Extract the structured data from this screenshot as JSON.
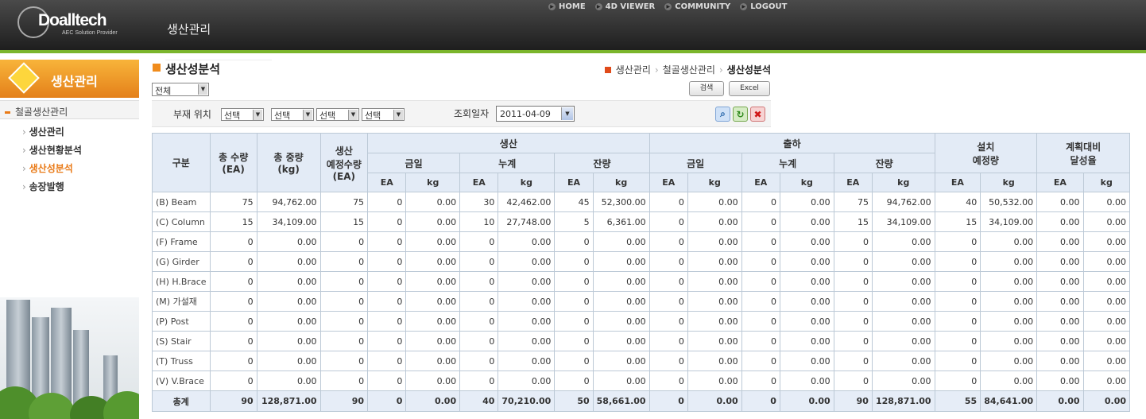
{
  "header": {
    "brand": "Doalltech",
    "brand_sub": "AEC Solution Provider",
    "section_title": "생산관리",
    "nav": [
      {
        "label": "HOME"
      },
      {
        "label": "4D VIEWER"
      },
      {
        "label": "COMMUNITY"
      },
      {
        "label": "LOGOUT"
      }
    ]
  },
  "sidebar": {
    "title": "생산관리",
    "group": "철골생산관리",
    "items": [
      {
        "label": "생산관리",
        "active": false
      },
      {
        "label": "생산현황분석",
        "active": false
      },
      {
        "label": "생산성분석",
        "active": true
      },
      {
        "label": "송장발행",
        "active": false
      }
    ]
  },
  "page": {
    "title": "생산성분석",
    "breadcrumb": [
      "생산관리",
      "철골생산관리",
      "생산성분석"
    ],
    "filter_all": "전체",
    "search_btn": "검색",
    "excel_btn": "Excel",
    "position_label": "부재 위치",
    "selects": [
      "선택",
      "선택",
      "선택",
      "선택"
    ],
    "date_label": "조회일자",
    "date_value": "2011-04-09"
  },
  "colors": {
    "accent": "#e97a17",
    "header_green": "#7bb52c",
    "table_header": "#e3ebf6",
    "table_border": "#bcc9d6"
  },
  "icons": [
    "zoom-icon",
    "refresh-icon",
    "delete-icon"
  ],
  "table": {
    "headers": {
      "category": "구분",
      "total_qty": "총 수량",
      "total_qty_unit": "(EA)",
      "total_weight": "총 중량",
      "total_weight_unit": "(kg)",
      "planned_prod": "생산",
      "planned_prod2": "예정수량",
      "planned_prod_unit": "(EA)",
      "production": "생산",
      "shipping": "출하",
      "install": "설치",
      "install2": "예정량",
      "plan_ratio": "계획대비",
      "plan_ratio2": "달성율",
      "today": "금일",
      "cumulative": "누계",
      "remaining": "잔량",
      "ea": "EA",
      "kg": "kg"
    },
    "rows": [
      {
        "name": "(B) Beam",
        "cells": [
          "75",
          "94,762.00",
          "75",
          "0",
          "0.00",
          "30",
          "42,462.00",
          "45",
          "52,300.00",
          "0",
          "0.00",
          "0",
          "0.00",
          "75",
          "94,762.00",
          "40",
          "50,532.00",
          "0.00",
          "0.00"
        ]
      },
      {
        "name": "(C) Column",
        "cells": [
          "15",
          "34,109.00",
          "15",
          "0",
          "0.00",
          "10",
          "27,748.00",
          "5",
          "6,361.00",
          "0",
          "0.00",
          "0",
          "0.00",
          "15",
          "34,109.00",
          "15",
          "34,109.00",
          "0.00",
          "0.00"
        ]
      },
      {
        "name": "(F) Frame",
        "cells": [
          "0",
          "0.00",
          "0",
          "0",
          "0.00",
          "0",
          "0.00",
          "0",
          "0.00",
          "0",
          "0.00",
          "0",
          "0.00",
          "0",
          "0.00",
          "0",
          "0.00",
          "0.00",
          "0.00"
        ]
      },
      {
        "name": "(G) Girder",
        "cells": [
          "0",
          "0.00",
          "0",
          "0",
          "0.00",
          "0",
          "0.00",
          "0",
          "0.00",
          "0",
          "0.00",
          "0",
          "0.00",
          "0",
          "0.00",
          "0",
          "0.00",
          "0.00",
          "0.00"
        ]
      },
      {
        "name": "(H) H.Brace",
        "cells": [
          "0",
          "0.00",
          "0",
          "0",
          "0.00",
          "0",
          "0.00",
          "0",
          "0.00",
          "0",
          "0.00",
          "0",
          "0.00",
          "0",
          "0.00",
          "0",
          "0.00",
          "0.00",
          "0.00"
        ]
      },
      {
        "name": "(M) 가설재",
        "cells": [
          "0",
          "0.00",
          "0",
          "0",
          "0.00",
          "0",
          "0.00",
          "0",
          "0.00",
          "0",
          "0.00",
          "0",
          "0.00",
          "0",
          "0.00",
          "0",
          "0.00",
          "0.00",
          "0.00"
        ]
      },
      {
        "name": "(P) Post",
        "cells": [
          "0",
          "0.00",
          "0",
          "0",
          "0.00",
          "0",
          "0.00",
          "0",
          "0.00",
          "0",
          "0.00",
          "0",
          "0.00",
          "0",
          "0.00",
          "0",
          "0.00",
          "0.00",
          "0.00"
        ]
      },
      {
        "name": "(S) Stair",
        "cells": [
          "0",
          "0.00",
          "0",
          "0",
          "0.00",
          "0",
          "0.00",
          "0",
          "0.00",
          "0",
          "0.00",
          "0",
          "0.00",
          "0",
          "0.00",
          "0",
          "0.00",
          "0.00",
          "0.00"
        ]
      },
      {
        "name": "(T) Truss",
        "cells": [
          "0",
          "0.00",
          "0",
          "0",
          "0.00",
          "0",
          "0.00",
          "0",
          "0.00",
          "0",
          "0.00",
          "0",
          "0.00",
          "0",
          "0.00",
          "0",
          "0.00",
          "0.00",
          "0.00"
        ]
      },
      {
        "name": "(V) V.Brace",
        "cells": [
          "0",
          "0.00",
          "0",
          "0",
          "0.00",
          "0",
          "0.00",
          "0",
          "0.00",
          "0",
          "0.00",
          "0",
          "0.00",
          "0",
          "0.00",
          "0",
          "0.00",
          "0.00",
          "0.00"
        ]
      }
    ],
    "total": {
      "name": "총계",
      "cells": [
        "90",
        "128,871.00",
        "90",
        "0",
        "0.00",
        "40",
        "70,210.00",
        "50",
        "58,661.00",
        "0",
        "0.00",
        "0",
        "0.00",
        "90",
        "128,871.00",
        "55",
        "84,641.00",
        "0.00",
        "0.00"
      ]
    }
  }
}
